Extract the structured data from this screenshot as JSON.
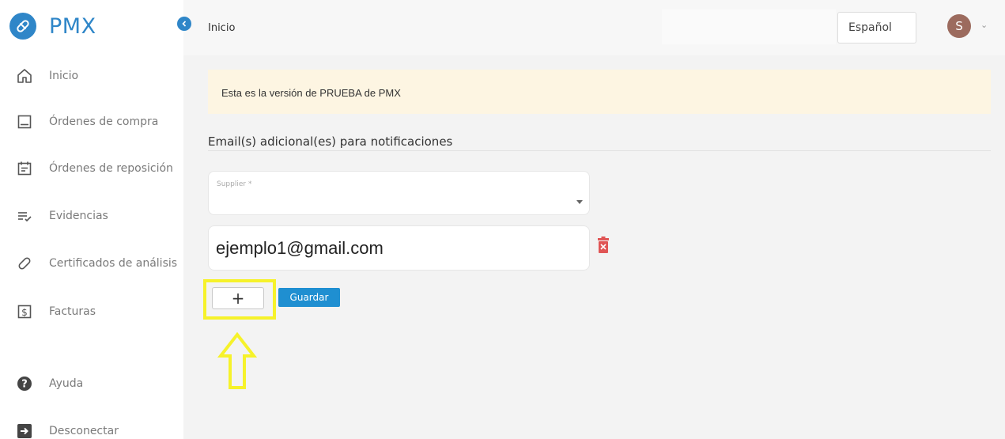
{
  "app": {
    "logo_text": "PMX"
  },
  "sidebar": {
    "items": [
      {
        "label": "Inicio",
        "icon": "home-icon"
      },
      {
        "label": "Órdenes de compra",
        "icon": "order-icon"
      },
      {
        "label": "Órdenes de reposición",
        "icon": "calendar-icon"
      },
      {
        "label": "Evidencias",
        "icon": "checklist-icon"
      },
      {
        "label": "Certificados de análisis",
        "icon": "link-icon"
      },
      {
        "label": "Facturas",
        "icon": "invoice-icon"
      },
      {
        "label": "Ayuda",
        "icon": "help-icon"
      },
      {
        "label": "Desconectar",
        "icon": "logout-icon"
      }
    ]
  },
  "header": {
    "breadcrumb": "Inicio",
    "language": "Español",
    "avatar_initial": "S"
  },
  "main": {
    "banner_text": "Esta es la versión de PRUEBA de PMX",
    "section_title": "Email(s) adicional(es) para notificaciones",
    "supplier_label": "Supplier *",
    "email_value": "ejemplo1@gmail.com",
    "add_label": "+",
    "save_label": "Guardar"
  },
  "colors": {
    "accent": "#2f86c8",
    "button_blue": "#1f8fd1",
    "banner_bg": "#fdf5e2",
    "highlight": "#f6f22a",
    "delete": "#e05555"
  }
}
